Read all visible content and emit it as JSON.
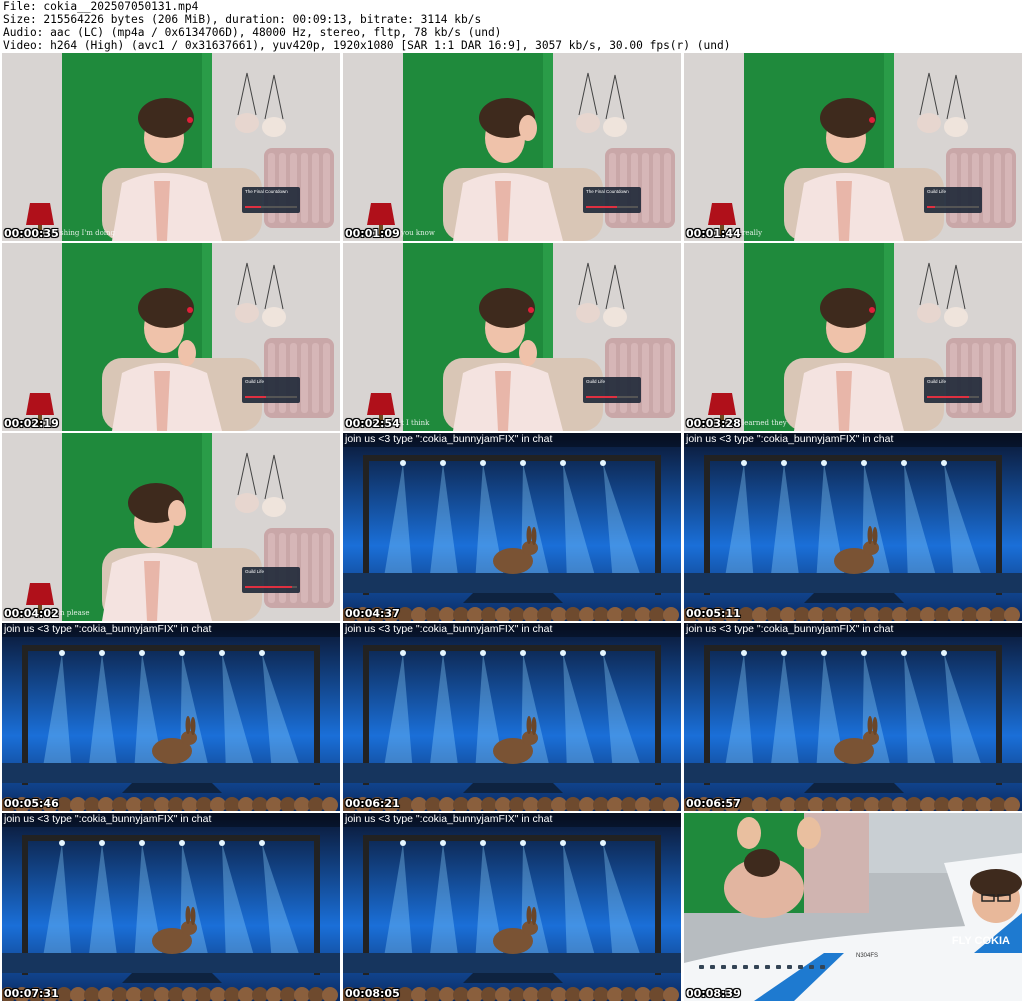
{
  "header": {
    "file_line": "File: cokia__202507050131.mp4",
    "size_line": "Size: 215564226 bytes (206 MiB), duration: 00:09:13, bitrate: 3114 kb/s",
    "audio_line": "Audio: aac (LC) (mp4a / 0x6134706D), 48000 Hz, stereo, fltp, 78 kb/s (und)",
    "video_line": "Video: h264 (High) (avc1 / 0x31637661), yuv420p, 1920x1080 [SAR 1:1 DAR 16:9], 3057 kb/s, 30.00 fps(r) (und)"
  },
  "stage_overlay": "join us <3 type \":cokia_bunnyjamFIX\" in chat",
  "now_playing": [
    "The Final Countdown",
    "Guild Life"
  ],
  "plane_text": "FLY COKIA",
  "tail_number": "N304FS",
  "colors": {
    "room_green": "#1f8a3c",
    "room_wall": "#d8d4d2",
    "stage_blue": "#1a6fd8",
    "stage_dark": "#0a1530",
    "plane_stripe": "#1e7ad0"
  },
  "thumbs": [
    {
      "kind": "room",
      "ts": "00:00:35",
      "caption": "shing I'm doing",
      "np": "The Final Countdown",
      "progress": 0.3
    },
    {
      "kind": "room",
      "ts": "00:01:09",
      "caption": "you know",
      "np": "The Final Countdown",
      "progress": 0.6
    },
    {
      "kind": "room",
      "ts": "00:01:44",
      "caption": "really",
      "np": "Guild Life",
      "progress": 0.15
    },
    {
      "kind": "room",
      "ts": "00:02:19",
      "caption": "",
      "np": "Guild Life",
      "progress": 0.4
    },
    {
      "kind": "room",
      "ts": "00:02:54",
      "caption": "t I think",
      "np": "Guild Life",
      "progress": 0.6
    },
    {
      "kind": "room",
      "ts": "00:03:28",
      "caption": "learned they",
      "np": "Guild Life",
      "progress": 0.8
    },
    {
      "kind": "room",
      "ts": "00:04:02",
      "caption": "n please",
      "np": "Guild Life",
      "progress": 0.9
    },
    {
      "kind": "stage",
      "ts": "00:04:37"
    },
    {
      "kind": "stage",
      "ts": "00:05:11"
    },
    {
      "kind": "stage",
      "ts": "00:05:46"
    },
    {
      "kind": "stage",
      "ts": "00:06:21"
    },
    {
      "kind": "stage",
      "ts": "00:06:57"
    },
    {
      "kind": "stage",
      "ts": "00:07:31"
    },
    {
      "kind": "stage",
      "ts": "00:08:05"
    },
    {
      "kind": "plane",
      "ts": "00:08:39"
    }
  ]
}
